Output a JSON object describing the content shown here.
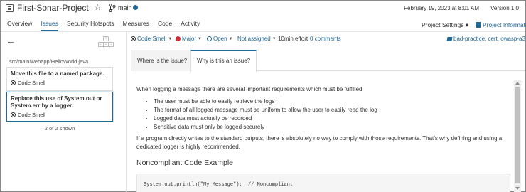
{
  "header": {
    "project_name": "First-Sonar-Project",
    "star_icon": "☆",
    "branch": "main",
    "analysis_date": "February 19, 2023 at 8:01 AM",
    "version": "Version 1.0"
  },
  "nav": {
    "tabs": [
      "Overview",
      "Issues",
      "Security Hotspots",
      "Measures",
      "Code",
      "Activity"
    ],
    "active_tab": "Issues",
    "project_settings": "Project Settings",
    "project_information": "Project Information"
  },
  "left_panel": {
    "back_icon": "←",
    "file_path": "src/main/webapp/HelloWorld.java",
    "issues": [
      {
        "title": "Move this file to a named package.",
        "type": "Code Smell",
        "selected": false
      },
      {
        "title": "Replace this use of System.out or System.err by a logger.",
        "type": "Code Smell",
        "selected": true
      }
    ],
    "shown_count": "2 of 2 shown"
  },
  "issue_meta": {
    "type": "Code Smell",
    "severity": "Major",
    "status": "Open",
    "assignee": "Not assigned",
    "effort": "10min effort",
    "comments": "0 comments",
    "tags": "bad-practice, cert, owasp-a3"
  },
  "rule_tabs": {
    "where": "Where is the issue?",
    "why": "Why is this an issue?",
    "active": "why"
  },
  "content": {
    "intro": "When logging a message there are several important requirements which must be fulfilled:",
    "bullets": [
      "The user must be able to easily retrieve the logs",
      "The format of all logged message must be uniform to allow the user to easily read the log",
      "Logged data must actually be recorded",
      "Sensitive data must only be logged securely"
    ],
    "paragraph": "If a program directly writes to the standard outputs, there is absolutely no way to comply with those requirements. That’s why defining and using a dedicated logger is highly recommended.",
    "heading": "Noncompliant Code Example",
    "code": "System.out.println(\"My Message\");  // Noncompliant"
  },
  "colors": {
    "accent": "#236a97",
    "severity_major": "#d02f3a"
  }
}
